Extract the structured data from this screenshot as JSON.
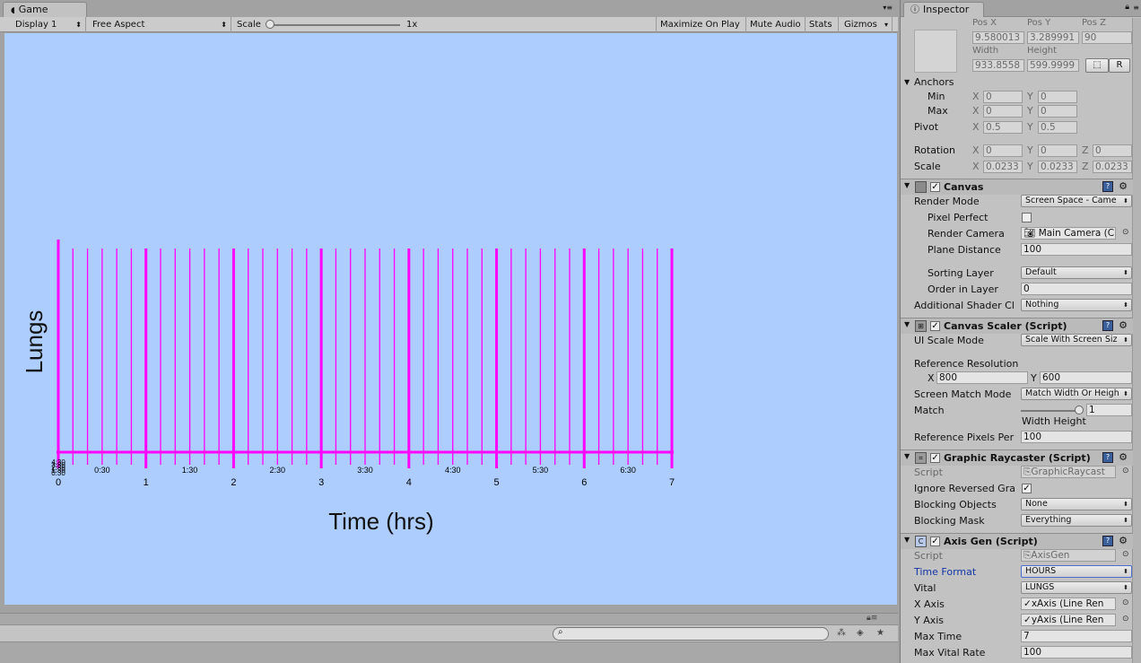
{
  "game": {
    "tab_label": "Game",
    "toolbar": {
      "display": "Display 1",
      "aspect": "Free Aspect",
      "scale_label": "Scale",
      "scale_value": "1x",
      "maximize_on_play": "Maximize On Play",
      "mute_audio": "Mute Audio",
      "stats": "Stats",
      "gizmos": "Gizmos"
    }
  },
  "chart_data": {
    "type": "line",
    "ylabel": "Lungs",
    "xlabel": "Time (hrs)",
    "major_ticks": [
      "0",
      "1",
      "2",
      "3",
      "4",
      "5",
      "6",
      "7"
    ],
    "half_ticks": [
      "0:30",
      "1:30",
      "2:30",
      "3:30",
      "4:30",
      "5:30",
      "6:30"
    ],
    "overlapping_labels_at_zero": [
      "4:30",
      "3:30",
      "2:30",
      "1:30",
      "0:30"
    ],
    "xlim": [
      0,
      7
    ],
    "subdivisions_per_hour": 6,
    "line_color": "#ff00ff",
    "background": "#adcdff"
  },
  "inspector": {
    "tab_label": "Inspector",
    "transform": {
      "pos_x_label": "Pos X",
      "pos_y_label": "Pos Y",
      "pos_z_label": "Pos Z",
      "pos_x": "9.580013",
      "pos_y": "3.289991",
      "pos_z": "90",
      "width_label": "Width",
      "height_label": "Height",
      "width": "933.8558",
      "height": "599.9999",
      "r_button": "R",
      "anchors_label": "Anchors",
      "min_label": "Min",
      "max_label": "Max",
      "x_label": "X",
      "y_label": "Y",
      "z_label": "Z",
      "min_x": "0",
      "min_y": "0",
      "max_x": "0",
      "max_y": "0",
      "pivot_label": "Pivot",
      "pivot_x": "0.5",
      "pivot_y": "0.5",
      "rotation_label": "Rotation",
      "rot_x": "0",
      "rot_y": "0",
      "rot_z": "0",
      "scale_label": "Scale",
      "scale_x": "0.0233",
      "scale_y": "0.0233",
      "scale_z": "0.0233"
    },
    "canvas": {
      "title": "Canvas",
      "render_mode_label": "Render Mode",
      "render_mode": "Screen Space - Came",
      "pixel_perfect_label": "Pixel Perfect",
      "render_camera_label": "Render Camera",
      "render_camera": "Main Camera (C",
      "plane_distance_label": "Plane Distance",
      "plane_distance": "100",
      "sorting_layer_label": "Sorting Layer",
      "sorting_layer": "Default",
      "order_in_layer_label": "Order in Layer",
      "order_in_layer": "0",
      "additional_shader_label": "Additional Shader Cl",
      "additional_shader": "Nothing"
    },
    "canvas_scaler": {
      "title": "Canvas Scaler (Script)",
      "ui_scale_mode_label": "UI Scale Mode",
      "ui_scale_mode": "Scale With Screen Siz",
      "ref_resolution_label": "Reference Resolution",
      "x_label": "X",
      "ref_x": "800",
      "y_label": "Y",
      "ref_y": "600",
      "screen_match_label": "Screen Match Mode",
      "screen_match": "Match Width Or Heigh",
      "match_label": "Match",
      "match_value": "1",
      "match_caption": "Width Height",
      "ref_pixels_label": "Reference Pixels Per",
      "ref_pixels": "100"
    },
    "graphic_raycaster": {
      "title": "Graphic Raycaster (Script)",
      "script_label": "Script",
      "script": "GraphicRaycast",
      "ignore_reversed_label": "Ignore Reversed Gra",
      "blocking_objects_label": "Blocking Objects",
      "blocking_objects": "None",
      "blocking_mask_label": "Blocking Mask",
      "blocking_mask": "Everything"
    },
    "axis_gen": {
      "title": "Axis Gen (Script)",
      "script_label": "Script",
      "script": "AxisGen",
      "time_format_label": "Time Format",
      "time_format": "HOURS",
      "vital_label": "Vital",
      "vital": "LUNGS",
      "x_axis_label": "X Axis",
      "x_axis": "xAxis (Line Ren",
      "y_axis_label": "Y Axis",
      "y_axis": "yAxis (Line Ren",
      "max_time_label": "Max Time",
      "max_time": "7",
      "max_vital_label": "Max Vital Rate",
      "max_vital": "100"
    }
  }
}
